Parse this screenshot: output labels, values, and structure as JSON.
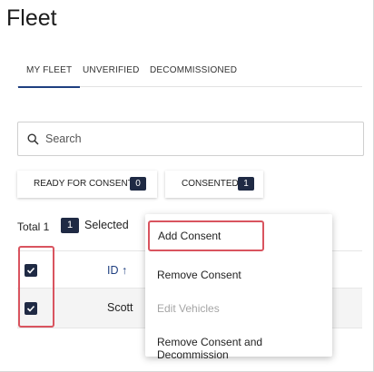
{
  "page": {
    "title": "Fleet"
  },
  "tabs": [
    {
      "label": "MY FLEET",
      "active": true
    },
    {
      "label": "UNVERIFIED",
      "active": false
    },
    {
      "label": "DECOMMISSIONED",
      "active": false
    }
  ],
  "search": {
    "placeholder": "Search",
    "value": "",
    "icon": "search-icon"
  },
  "filters": [
    {
      "label": "READY FOR CONSENT",
      "count": "0"
    },
    {
      "label": "CONSENTED",
      "count": "1"
    }
  ],
  "summary": {
    "total_label": "Total 1",
    "selected_count": "1",
    "selected_label": "Selected"
  },
  "table": {
    "header": {
      "id_label": "ID ↑",
      "select_all_checked": true
    },
    "rows": [
      {
        "name": "Scott",
        "checked": true
      }
    ]
  },
  "context_menu": {
    "items": [
      {
        "label": "Add Consent",
        "enabled": true,
        "highlighted": true
      },
      {
        "label": "Remove Consent",
        "enabled": true
      },
      {
        "label": "Edit Vehicles",
        "enabled": false
      },
      {
        "label": "Remove Consent and Decommission",
        "enabled": true
      }
    ]
  },
  "colors": {
    "accent": "#1f3f80",
    "badge": "#1f2a44",
    "highlight": "#d9545f",
    "disabled_text": "#a5a5a5"
  }
}
